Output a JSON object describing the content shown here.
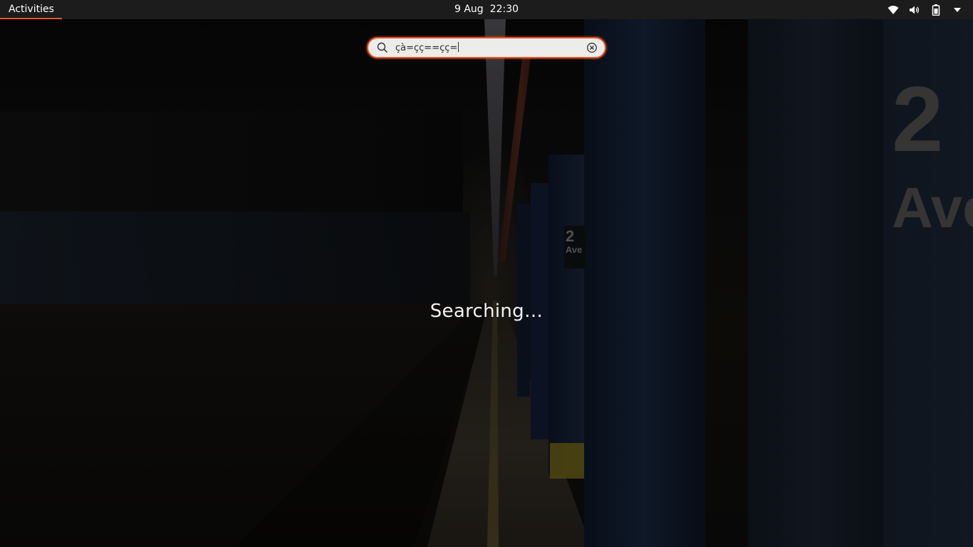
{
  "topbar": {
    "activities_label": "Activities",
    "date": "9 Aug",
    "time": "22:30",
    "status_icons": [
      "wifi-icon",
      "volume-icon",
      "battery-icon",
      "system-menu-arrow-icon"
    ]
  },
  "search": {
    "value": "çà=çç==çç=",
    "icons": [
      "search-icon",
      "clear-icon"
    ]
  },
  "results": {
    "status_text": "Searching…"
  },
  "wallpaper": {
    "sign_large_number": "2",
    "sign_large_text": "Ave",
    "sign_small_number": "2",
    "sign_small_text": "Ave"
  },
  "colors": {
    "accent": "#e95420",
    "topbar_bg": "#1c1c1c"
  }
}
